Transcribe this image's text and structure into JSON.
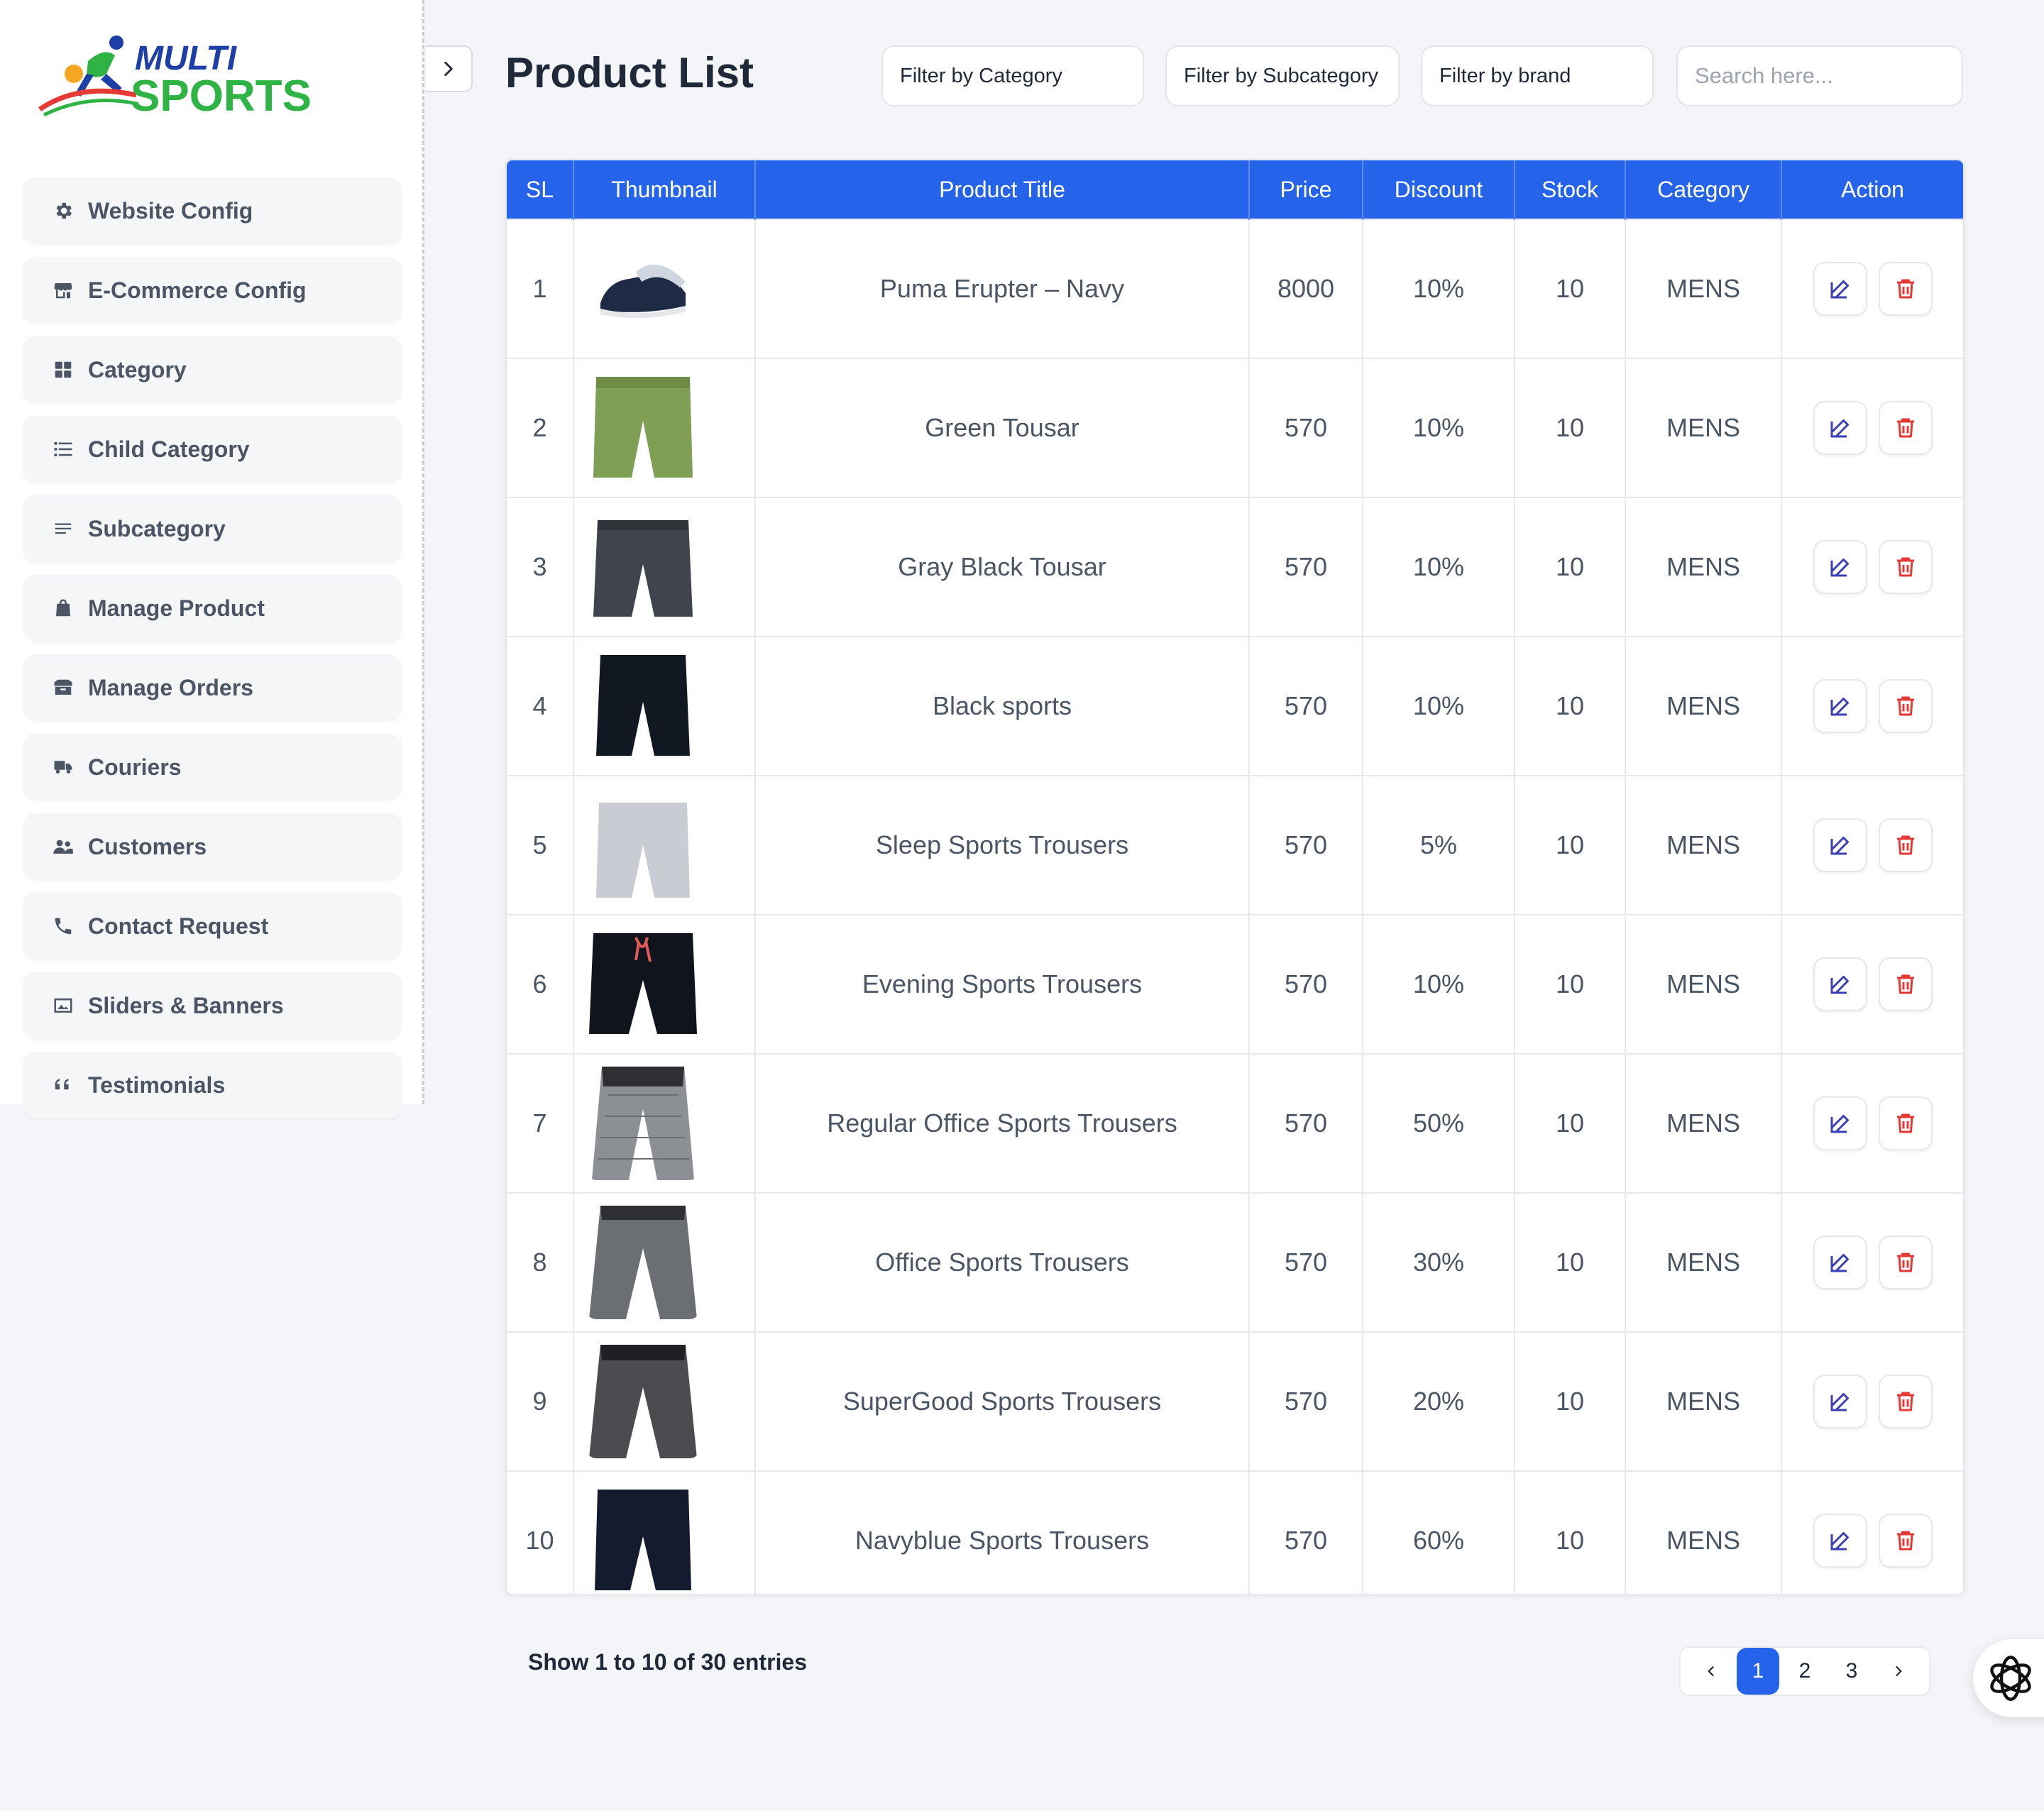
{
  "brand": {
    "line1": "MULTI",
    "line2": "SPORTS",
    "colors": {
      "blue": "#1d3fa6",
      "green": "#2fb344",
      "red": "#e53935"
    }
  },
  "sidebar": {
    "items": [
      {
        "label": "Website Config",
        "icon": "gear-icon"
      },
      {
        "label": "E-Commerce Config",
        "icon": "store-icon"
      },
      {
        "label": "Category",
        "icon": "grid-icon"
      },
      {
        "label": "Child Category",
        "icon": "list-icon"
      },
      {
        "label": "Subcategory",
        "icon": "lines-icon"
      },
      {
        "label": "Manage Product",
        "icon": "bag-icon"
      },
      {
        "label": "Manage Orders",
        "icon": "box-icon"
      },
      {
        "label": "Couriers",
        "icon": "truck-icon"
      },
      {
        "label": "Customers",
        "icon": "users-icon"
      },
      {
        "label": "Contact Request",
        "icon": "phone-icon"
      },
      {
        "label": "Sliders & Banners",
        "icon": "image-icon"
      },
      {
        "label": "Testimonials",
        "icon": "quote-icon"
      }
    ]
  },
  "header": {
    "title": "Product List",
    "filter_category": "Filter by Category",
    "filter_subcategory": "Filter by Subcategory",
    "filter_brand": "Filter by brand",
    "search_placeholder": "Search here..."
  },
  "table": {
    "columns": [
      "SL",
      "Thumbnail",
      "Product Title",
      "Price",
      "Discount",
      "Stock",
      "Category",
      "Action"
    ],
    "rows": [
      {
        "sl": "1",
        "thumb": "sneaker",
        "title": "Puma Erupter – Navy",
        "price": "8000",
        "discount": "10%",
        "stock": "10",
        "category": "MENS"
      },
      {
        "sl": "2",
        "thumb": "green-shorts",
        "title": "Green Tousar",
        "price": "570",
        "discount": "10%",
        "stock": "10",
        "category": "MENS"
      },
      {
        "sl": "3",
        "thumb": "gray-shorts",
        "title": "Gray Black Tousar",
        "price": "570",
        "discount": "10%",
        "stock": "10",
        "category": "MENS"
      },
      {
        "sl": "4",
        "thumb": "black-shorts",
        "title": "Black sports",
        "price": "570",
        "discount": "10%",
        "stock": "10",
        "category": "MENS"
      },
      {
        "sl": "5",
        "thumb": "light-gray-shorts",
        "title": "Sleep Sports Trousers",
        "price": "570",
        "discount": "5%",
        "stock": "10",
        "category": "MENS"
      },
      {
        "sl": "6",
        "thumb": "black-shorts-red-string",
        "title": "Evening Sports Trousers",
        "price": "570",
        "discount": "10%",
        "stock": "10",
        "category": "MENS"
      },
      {
        "sl": "7",
        "thumb": "plaid-trousers",
        "title": "Regular Office Sports Trousers",
        "price": "570",
        "discount": "50%",
        "stock": "10",
        "category": "MENS"
      },
      {
        "sl": "8",
        "thumb": "gray-joggers",
        "title": "Office Sports Trousers",
        "price": "570",
        "discount": "30%",
        "stock": "10",
        "category": "MENS"
      },
      {
        "sl": "9",
        "thumb": "dark-gray-joggers",
        "title": "SuperGood Sports Trousers",
        "price": "570",
        "discount": "20%",
        "stock": "10",
        "category": "MENS"
      },
      {
        "sl": "10",
        "thumb": "navy-shorts",
        "title": "Navyblue Sports Trousers",
        "price": "570",
        "discount": "60%",
        "stock": "10",
        "category": "MENS"
      }
    ]
  },
  "footer": {
    "entries_text": "Show 1 to 10 of 30 entries",
    "pages": [
      "1",
      "2",
      "3"
    ],
    "active_page": "1"
  },
  "colors": {
    "primary": "#2563eb",
    "edit": "#3b3fb6",
    "delete": "#e53935"
  }
}
